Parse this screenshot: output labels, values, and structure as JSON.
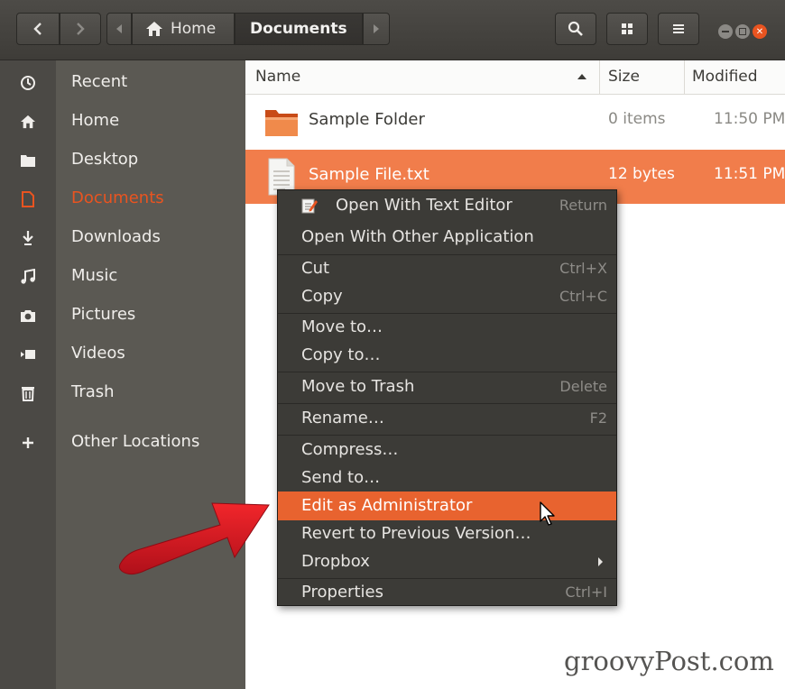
{
  "header": {
    "back_icon": "chevron-left-icon",
    "forward_icon": "chevron-right-icon",
    "path_left_icon": "triangle-left-icon",
    "path_right_icon": "triangle-right-icon",
    "home_crumb_icon": "home-icon",
    "home_crumb": "Home",
    "current_crumb": "Documents",
    "search_icon": "search-icon",
    "view_icon": "grid-view-icon",
    "menu_icon": "hamburger-menu-icon"
  },
  "sidebar": {
    "items": [
      {
        "label": "Recent",
        "icon": "clock-icon"
      },
      {
        "label": "Home",
        "icon": "home-icon"
      },
      {
        "label": "Desktop",
        "icon": "folder-icon"
      },
      {
        "label": "Documents",
        "icon": "document-icon",
        "active": true
      },
      {
        "label": "Downloads",
        "icon": "download-icon"
      },
      {
        "label": "Music",
        "icon": "music-icon"
      },
      {
        "label": "Pictures",
        "icon": "camera-icon"
      },
      {
        "label": "Videos",
        "icon": "video-icon"
      },
      {
        "label": "Trash",
        "icon": "trash-icon"
      },
      {
        "label": "Other Locations",
        "icon": "plus-icon"
      }
    ]
  },
  "columns": {
    "name": "Name",
    "size": "Size",
    "modified": "Modified"
  },
  "files": [
    {
      "name": "Sample Folder",
      "size": "0 items",
      "modified": "11:50 PM",
      "icon": "folder-icon"
    },
    {
      "name": "Sample File.txt",
      "size": "12 bytes",
      "modified": "11:51 PM",
      "icon": "text-file-icon",
      "selected": true
    }
  ],
  "context_menu": {
    "items": [
      {
        "label": "Open With Text Editor",
        "accel": "Return",
        "icon": "text-editor-icon"
      },
      {
        "label": "Open With Other Application",
        "accel": ""
      },
      {
        "label": "Cut",
        "accel": "Ctrl+X"
      },
      {
        "label": "Copy",
        "accel": "Ctrl+C"
      },
      {
        "label": "Move to…",
        "accel": ""
      },
      {
        "label": "Copy to…",
        "accel": ""
      },
      {
        "label": "Move to Trash",
        "accel": "Delete"
      },
      {
        "label": "Rename…",
        "accel": "F2"
      },
      {
        "label": "Compress…",
        "accel": ""
      },
      {
        "label": "Send to…",
        "accel": ""
      },
      {
        "label": "Edit as Administrator",
        "accel": "",
        "highlighted": true
      },
      {
        "label": "Revert to Previous Version…",
        "accel": ""
      },
      {
        "label": "Dropbox",
        "accel": "",
        "submenu": true
      },
      {
        "label": "Properties",
        "accel": "Ctrl+I"
      }
    ]
  },
  "annotation": {
    "arrow": "red-arrow-icon",
    "pointer": "mouse-pointer-icon"
  },
  "watermark": "groovyPost.com",
  "colors": {
    "accent": "#e95420",
    "selection": "#f17d4b",
    "menu_bg": "#3c3b37",
    "arrow": "#e11b22"
  }
}
